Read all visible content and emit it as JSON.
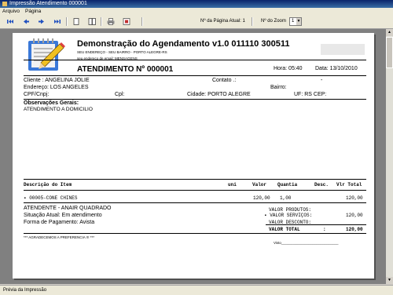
{
  "window": {
    "title": "Impressão Atendimento 000001"
  },
  "menu": [
    "Arquivo",
    "Página"
  ],
  "toolbar": {
    "page_label": "Nº da Página Atual: 1",
    "zoom_label": "Nº do Zoom",
    "zoom_value": "1"
  },
  "status": {
    "text": "Prévia da Impressão"
  },
  "report": {
    "title": "Demonstração do Agendamento v1.0 011110 300511",
    "address": "SEU ENDEREÇO - SEU BAIRRO - PORTO ALEGRE-RS",
    "email": "seu endereço de email: MENSAGENS",
    "atendimento": "ATENDIMENTO Nº 000001",
    "hora": "Hora: 05:40",
    "data": "Data: 13/10/2010",
    "cliente": "Cliente   : ANGELINA JOLIE",
    "contato": "Contato .:",
    "contato_dash": "-",
    "endereco": "Endereço: LOS ANGELES",
    "bairro": "Bairro:",
    "cpf": "CPF/Cnpj:",
    "cpl": "Cpl:",
    "cidade": "Cidade: PORTO ALEGRE",
    "uf": "UF: RS  CEP:",
    "obs_title": "Observações Gerais:",
    "obs_text": "ATENDIMENTO A DOMICILIO",
    "columns": {
      "desc": "Descrição do Item",
      "uni": "uni",
      "valor": "Valor",
      "quant": "Quantia",
      "descto": "Desc.",
      "vlr_total": "Vlr Total"
    },
    "item": {
      "desc": "00005-CONE CHINES",
      "valor": "120,00",
      "quant": "1,00",
      "total": "120,00"
    },
    "atendente": "ATENDENTE - ANAIR QUADRADO",
    "situacao": "Situação Atual: Em atendimento",
    "forma_pag": "Forma de Pagamento: Avista",
    "vp_label": "VALOR PRODUTOS:",
    "vs_label": "VALOR SERVIÇOS:",
    "vs_value": "120,00",
    "vd_label": "VALOR DESCONTO:",
    "vt_label": "VALOR TOTAL",
    "vt_colon": ":",
    "vt_value": "120,00",
    "agradecimento": "*** AGRADECEMOS A PREFERENCIA !!! ***",
    "visto": "Visto_____________________________"
  }
}
